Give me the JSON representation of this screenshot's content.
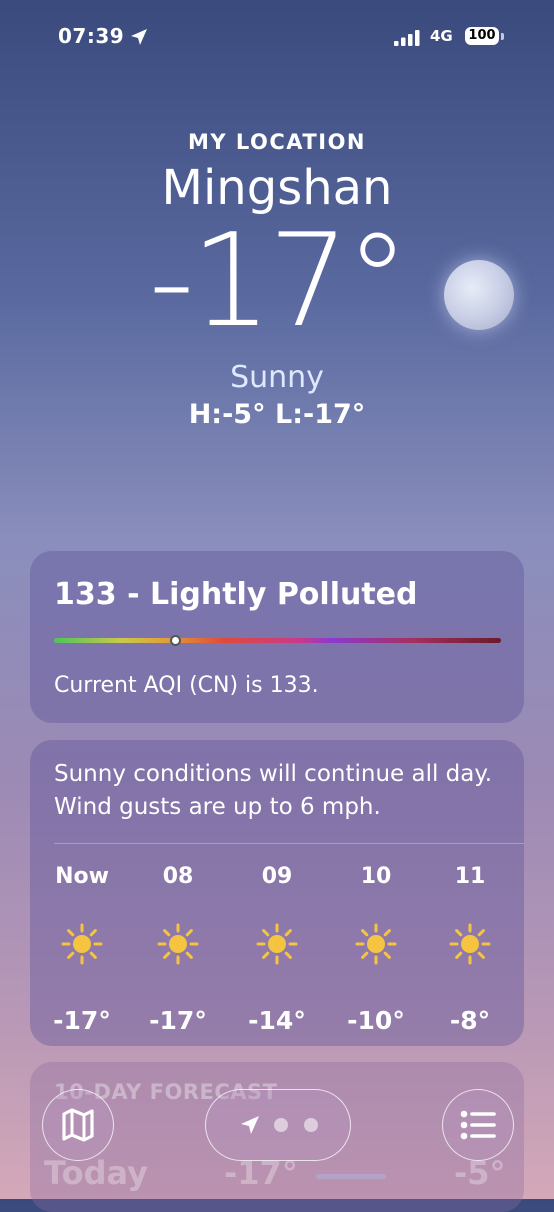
{
  "status_bar": {
    "time": "07:39",
    "network": "4G",
    "battery": "100"
  },
  "header": {
    "my_location": "MY LOCATION",
    "city": "Mingshan",
    "temperature": "-17°",
    "condition": "Sunny",
    "high_low": "H:-5°  L:-17°"
  },
  "aqi": {
    "title": "133 - Lightly Polluted",
    "description": "Current AQI (CN) is 133.",
    "level_fraction": 0.27
  },
  "hourly": {
    "summary": "Sunny conditions will continue all day. Wind gusts are up to 6 mph.",
    "items": [
      {
        "label": "Now",
        "icon": "sun-icon",
        "temp": "-17°"
      },
      {
        "label": "08",
        "icon": "sun-icon",
        "temp": "-17°"
      },
      {
        "label": "09",
        "icon": "sun-icon",
        "temp": "-14°"
      },
      {
        "label": "10",
        "icon": "sun-icon",
        "temp": "-10°"
      },
      {
        "label": "11",
        "icon": "sun-icon",
        "temp": "-8°"
      }
    ]
  },
  "forecast": {
    "header": "10-DAY FORECAST",
    "today": {
      "day": "Today",
      "low": "-17°",
      "high": "-5°"
    }
  },
  "colors": {
    "sun": "#f5c542",
    "condition_text": "#e0e8ff"
  }
}
